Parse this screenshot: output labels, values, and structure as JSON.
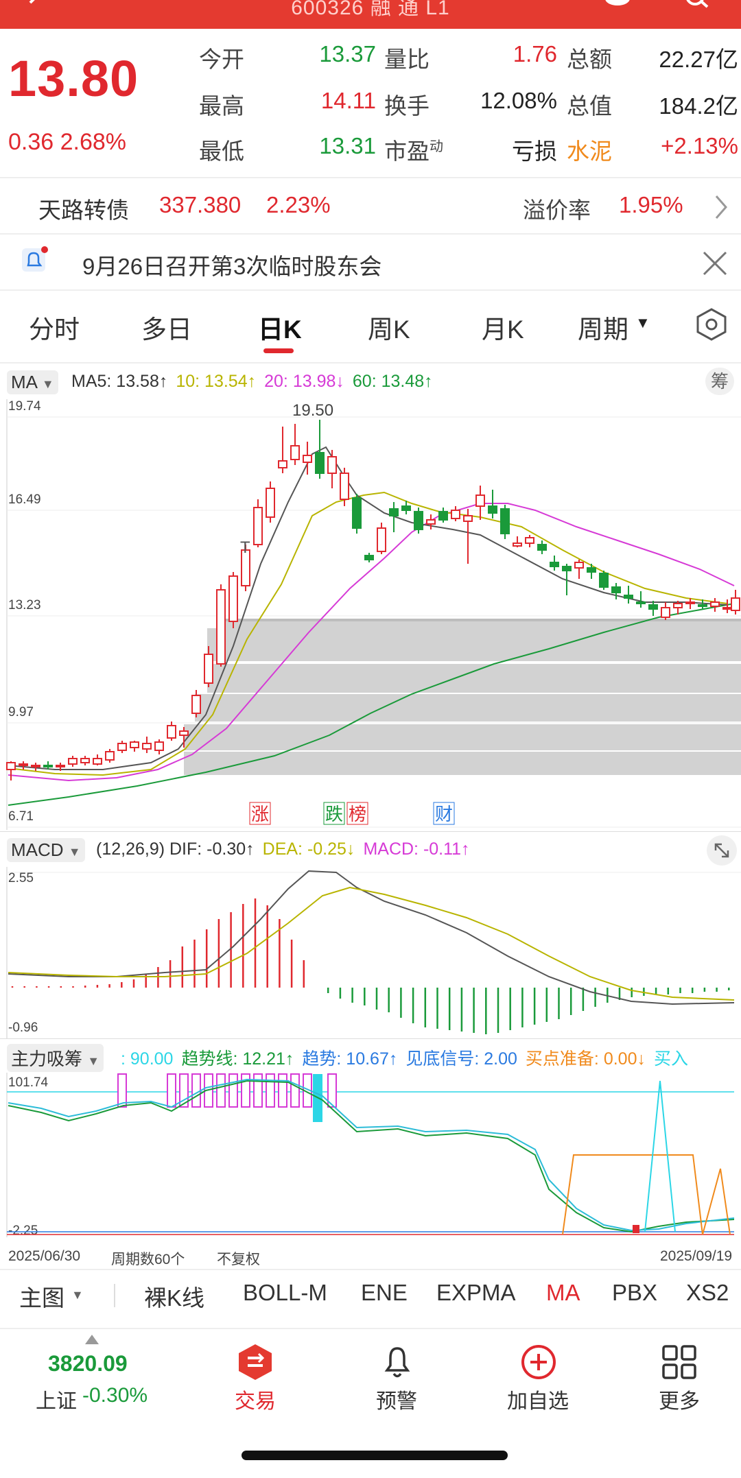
{
  "header": {
    "code": "600326 融 通 L1"
  },
  "quote": {
    "price": "13.80",
    "change": "0.36  2.68%",
    "stats": [
      {
        "label": "今开",
        "value": "13.37",
        "color": "green"
      },
      {
        "label": "量比",
        "value": "1.76",
        "color": "red"
      },
      {
        "label": "总额",
        "value": "22.27亿",
        "color": "dark"
      },
      {
        "label": "最高",
        "value": "14.11",
        "color": "red"
      },
      {
        "label": "换手",
        "value": "12.08%",
        "color": "dark"
      },
      {
        "label": "总值",
        "value": "184.2亿",
        "color": "dark"
      },
      {
        "label": "最低",
        "value": "13.31",
        "color": "green"
      },
      {
        "label": "市盈",
        "sup": "动",
        "value": "亏损",
        "color": "dark"
      },
      {
        "label": "水泥",
        "value": "+2.13%",
        "color": "red"
      }
    ]
  },
  "bond": {
    "name": "天路转债",
    "price": "337.380",
    "pct": "2.23%",
    "premium_label": "溢价率",
    "premium": "1.95%"
  },
  "notice": {
    "text": "9月26日召开第3次临时股东会"
  },
  "tabs": [
    "分时",
    "多日",
    "日K",
    "周K",
    "月K",
    "周期"
  ],
  "active_tab": "日K",
  "ma": {
    "selector": "MA",
    "legend": [
      {
        "text": "MA5: 13.58↑",
        "color": "#333333"
      },
      {
        "text": "10: 13.54↑",
        "color": "#b8b400"
      },
      {
        "text": "20: 13.98↓",
        "color": "#d63ad6"
      },
      {
        "text": "60: 13.48↑",
        "color": "#1a9a3a"
      }
    ],
    "chip_button": "筹",
    "y_ticks": [
      "19.74",
      "16.49",
      "13.23",
      "9.97",
      "6.71"
    ],
    "peak_label": "19.50",
    "events": [
      {
        "text": "涨",
        "color": "#e0282e"
      },
      {
        "text": "跌",
        "color": "#1a9a3a"
      },
      {
        "text": "榜",
        "color": "#e0282e"
      },
      {
        "text": "财",
        "color": "#2a7ae0"
      }
    ]
  },
  "macd": {
    "selector": "MACD",
    "legend": [
      {
        "text": "(12,26,9) DIF: -0.30↑",
        "color": "#333333"
      },
      {
        "text": "DEA: -0.25↓",
        "color": "#b8b400"
      },
      {
        "text": "MACD: -0.11↑",
        "color": "#d63ad6"
      }
    ],
    "y_ticks": [
      "2.55",
      "-0.96"
    ]
  },
  "zlxc": {
    "selector": "主力吸筹",
    "legend": [
      {
        "text": ": 90.00",
        "color": "#2cd6e6"
      },
      {
        "text": "趋势线: 12.21↑",
        "color": "#1a9a3a"
      },
      {
        "text": "趋势: 10.67↑",
        "color": "#2a7ae0"
      },
      {
        "text": "见底信号: 2.00",
        "color": "#2a7ae0"
      },
      {
        "text": "买点准备: 0.00↓",
        "color": "#f08a1c"
      },
      {
        "text": "买入",
        "color": "#2cd6e6"
      }
    ],
    "y_ticks": [
      "101.74",
      "-2.25"
    ]
  },
  "xaxis": {
    "start": "2025/06/30",
    "period": "周期数60个",
    "adjust": "不复权",
    "end": "2025/09/19"
  },
  "indicators": [
    "主图",
    "裸K线",
    "BOLL-M",
    "ENE",
    "EXPMA",
    "MA",
    "PBX",
    "XS2"
  ],
  "active_indicator": "MA",
  "footer": {
    "index_value": "3820.09",
    "index_name": "上证",
    "index_change": "-0.30%",
    "nav": [
      "交易",
      "预警",
      "加自选",
      "更多"
    ]
  },
  "colors": {
    "up": "#e0282e",
    "down": "#1a9a3a",
    "brand": "#e43a30"
  }
}
